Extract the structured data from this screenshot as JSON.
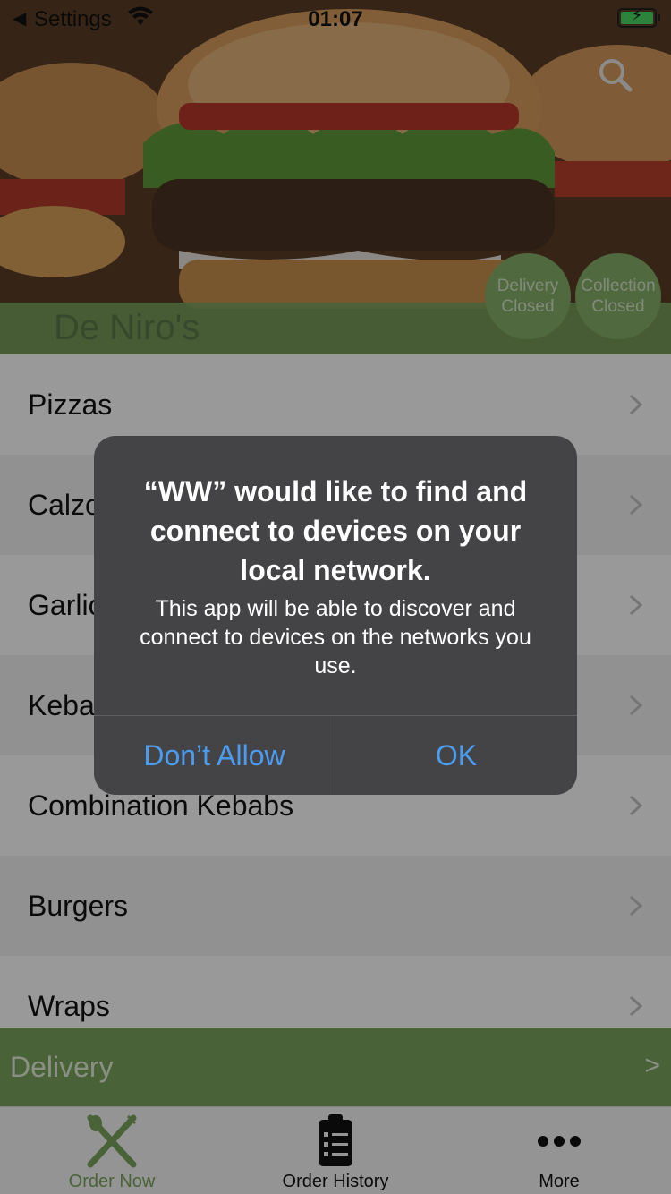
{
  "status_bar": {
    "back_label": "Settings",
    "time": "01:07",
    "battery_icon": "battery-charging-icon",
    "wifi_icon": "wifi-icon"
  },
  "header": {
    "restaurant_name": "De Niro's",
    "search_icon": "search-icon",
    "delivery_status": {
      "line1": "Delivery",
      "line2": "Closed"
    },
    "collection_status": {
      "line1": "Collection",
      "line2": "Closed"
    },
    "brand_color": "#7aa35d"
  },
  "menu": {
    "categories": [
      {
        "label": "Pizzas"
      },
      {
        "label": "Calzones"
      },
      {
        "label": "Garlic Bread"
      },
      {
        "label": "Kebabs"
      },
      {
        "label": "Combination Kebabs"
      },
      {
        "label": "Burgers"
      },
      {
        "label": "Wraps"
      }
    ],
    "chevron_icon": "chevron-right-icon"
  },
  "delivery_bar": {
    "label": "Delivery",
    "arrow": ">"
  },
  "tab_bar": {
    "tabs": [
      {
        "label": "Order Now",
        "icon": "fork-knife-icon",
        "active": true
      },
      {
        "label": "Order History",
        "icon": "clipboard-list-icon",
        "active": false
      },
      {
        "label": "More",
        "icon": "more-dots-icon",
        "active": false
      }
    ]
  },
  "alert": {
    "title": "“WW” would like to find and connect to devices on your local network.",
    "message": "This app will be able to discover and connect to devices on the networks you use.",
    "deny_label": "Don’t Allow",
    "ok_label": "OK",
    "button_color": "#4a9cf0"
  }
}
